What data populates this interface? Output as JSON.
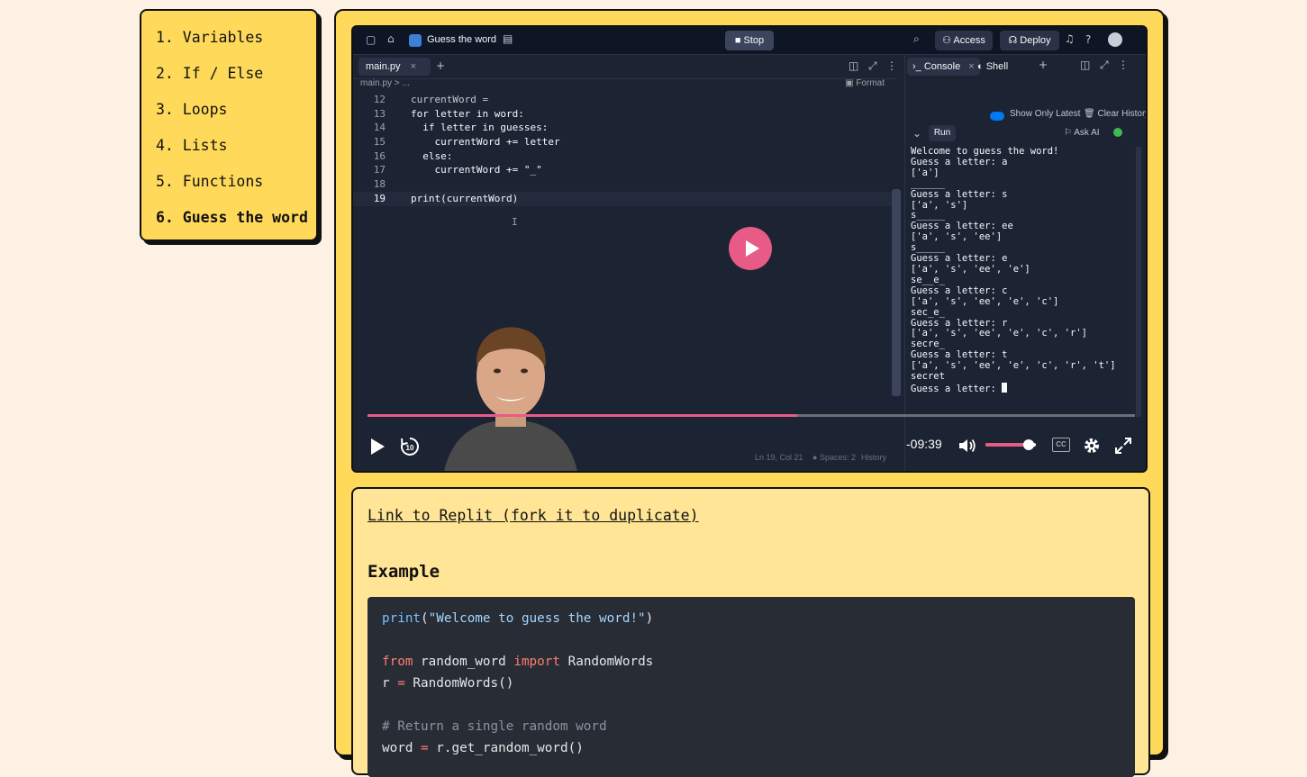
{
  "sidebar": {
    "items": [
      {
        "label": "1. Variables",
        "active": false
      },
      {
        "label": "2. If / Else",
        "active": false
      },
      {
        "label": "3. Loops",
        "active": false
      },
      {
        "label": "4. Lists",
        "active": false
      },
      {
        "label": "5. Functions",
        "active": false
      },
      {
        "label": "6. Guess the word",
        "active": true
      }
    ]
  },
  "video": {
    "replit": {
      "repl_title": "Guess the word",
      "stop_label": "Stop",
      "access_label": "Access",
      "deploy_label": "Deploy",
      "help_glyph": "?",
      "editor_tab": "main.py",
      "breadcrumb": "main.py  >  ...",
      "format_label": "Format",
      "code_lines": [
        {
          "n": "12",
          "text": "currentWord = "
        },
        {
          "n": "13",
          "text": "for letter in word:"
        },
        {
          "n": "14",
          "text": "  if letter in guesses:"
        },
        {
          "n": "15",
          "text": "    currentWord += letter"
        },
        {
          "n": "16",
          "text": "  else:"
        },
        {
          "n": "17",
          "text": "    currentWord += \"_\""
        },
        {
          "n": "18",
          "text": ""
        },
        {
          "n": "19",
          "text": "print(currentWord)"
        }
      ],
      "console_tab": "Console",
      "shell_tab": "Shell",
      "show_only_latest": "Show Only Latest",
      "clear_history": "Clear History",
      "run_label": "Run",
      "ask_ai": "Ask AI",
      "console_output": "Welcome to guess the word!\nGuess a letter: a\n['a']\n______\nGuess a letter: s\n['a', 's']\ns_____\nGuess a letter: ee\n['a', 's', 'ee']\ns_____\nGuess a letter: e\n['a', 's', 'ee', 'e']\nse__e_\nGuess a letter: c\n['a', 's', 'ee', 'e', 'c']\nsec_e_\nGuess a letter: r\n['a', 's', 'ee', 'e', 'c', 'r']\nsecre_\nGuess a letter: t\n['a', 's', 'ee', 'e', 'c', 'r', 't']\nsecret\nGuess a letter: ",
      "status_pos": "Ln 19, Col 21",
      "status_spaces": "Spaces: 2",
      "status_history": "History"
    },
    "player": {
      "time_remaining": "-09:39",
      "progress_percent": 56,
      "volume_percent": 85,
      "rewind_seconds": "10",
      "cc_label": "CC"
    }
  },
  "content": {
    "link_text": "Link to Replit (fork it to duplicate)",
    "heading": "Example"
  }
}
